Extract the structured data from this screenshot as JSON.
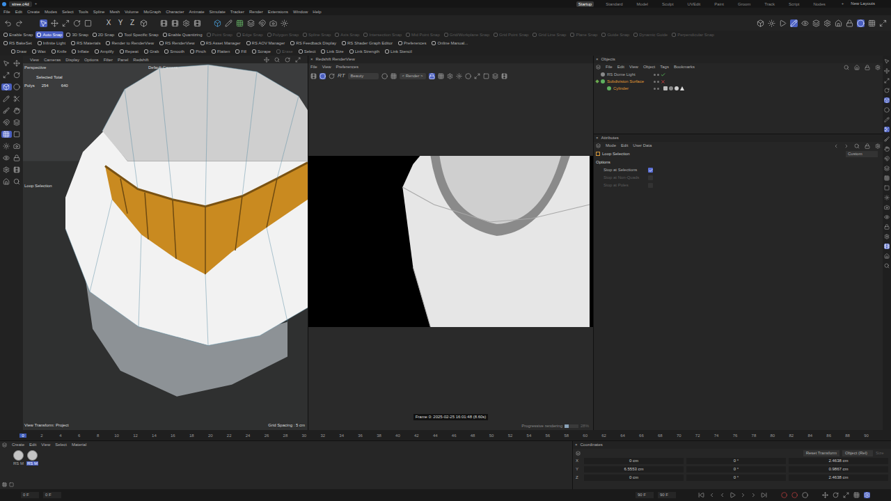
{
  "titlebar": {
    "file_tab": {
      "label": "stree.c4d",
      "selected": true
    },
    "new_tab": "+",
    "layouts": [
      {
        "label": "Startup",
        "selected": true
      },
      {
        "label": "Standard",
        "selected": false
      },
      {
        "label": "Model",
        "selected": false
      },
      {
        "label": "Sculpt",
        "selected": false
      },
      {
        "label": "UVEdit",
        "selected": false
      },
      {
        "label": "Paint",
        "selected": false
      },
      {
        "label": "Groom",
        "selected": false
      },
      {
        "label": "Track",
        "selected": false
      },
      {
        "label": "Script",
        "selected": false
      },
      {
        "label": "Nodes",
        "selected": false
      }
    ],
    "add_layout": "+",
    "new_layouts": "New Layouts"
  },
  "menu": [
    "File",
    "Edit",
    "Create",
    "Modes",
    "Select",
    "Tools",
    "Spline",
    "Mesh",
    "Volume",
    "MoGraph",
    "Character",
    "Animate",
    "Simulate",
    "Tracker",
    "Render",
    "Extensions",
    "Window",
    "Help"
  ],
  "toolbar": {
    "axis_locks": [
      {
        "label": "X",
        "on": false
      },
      {
        "label": "Y",
        "on": false
      },
      {
        "label": "Z",
        "on": false
      }
    ]
  },
  "snap_bar": [
    {
      "label": "Enable Snap",
      "on": false,
      "disabled": false
    },
    {
      "label": "Auto Snap",
      "on": true,
      "disabled": false
    },
    {
      "label": "3D Snap",
      "on": false,
      "disabled": false
    },
    {
      "label": "2D Snap",
      "on": false,
      "disabled": false
    },
    {
      "label": "Tool Specific Snap",
      "on": false,
      "disabled": false
    },
    {
      "label": "Enable Quantizing",
      "on": false,
      "disabled": false
    },
    {
      "label": "Point Snap",
      "on": false,
      "disabled": true
    },
    {
      "label": "Edge Snap",
      "on": false,
      "disabled": true
    },
    {
      "label": "Polygon Snap",
      "on": false,
      "disabled": true
    },
    {
      "label": "Spline Snap",
      "on": false,
      "disabled": true
    },
    {
      "label": "Axis Snap",
      "on": false,
      "disabled": true
    },
    {
      "label": "Intersection Snap",
      "on": false,
      "disabled": true
    },
    {
      "label": "Mid Point Snap",
      "on": false,
      "disabled": true
    },
    {
      "label": "Grid/Workplane Snap",
      "on": false,
      "disabled": true
    },
    {
      "label": "Grid Point Snap",
      "on": false,
      "disabled": true
    },
    {
      "label": "Grid Line Snap",
      "on": false,
      "disabled": true
    },
    {
      "label": "Plane Snap",
      "on": false,
      "disabled": true
    },
    {
      "label": "Guide Snap",
      "on": false,
      "disabled": true
    },
    {
      "label": "Dynamic Guide",
      "on": false,
      "disabled": true
    },
    {
      "label": "Perpendicular Snap",
      "on": false,
      "disabled": true
    }
  ],
  "redshift_bar": [
    {
      "label": "RS BakeSet",
      "on": false,
      "disabled": false
    },
    {
      "label": "Infinite Light",
      "on": false,
      "disabled": false
    },
    {
      "label": "RS Materials",
      "on": false,
      "disabled": false
    },
    {
      "label": "Render to RenderView",
      "on": false,
      "disabled": false
    },
    {
      "label": "RS RenderView",
      "on": false,
      "disabled": false
    },
    {
      "label": "RS Asset Manager",
      "on": false,
      "disabled": false
    },
    {
      "label": "RS AOV Manager",
      "on": false,
      "disabled": false
    },
    {
      "label": "RS Feedback Display",
      "on": false,
      "disabled": false
    },
    {
      "label": "RS Shader Graph Editor",
      "on": false,
      "disabled": false
    },
    {
      "label": "Preferences",
      "on": false,
      "disabled": false
    },
    {
      "label": "Online Manual...",
      "on": false,
      "disabled": false
    }
  ],
  "sculpt_bar": [
    {
      "label": "Draw",
      "on": false,
      "disabled": false
    },
    {
      "label": "Wax",
      "on": false,
      "disabled": false
    },
    {
      "label": "Knife",
      "on": false,
      "disabled": false
    },
    {
      "label": "Inflate",
      "on": false,
      "disabled": false
    },
    {
      "label": "Amplify",
      "on": false,
      "disabled": false
    },
    {
      "label": "Repeat",
      "on": false,
      "disabled": false
    },
    {
      "label": "Grab",
      "on": false,
      "disabled": false
    },
    {
      "label": "Smooth",
      "on": false,
      "disabled": false
    },
    {
      "label": "Pinch",
      "on": false,
      "disabled": false
    },
    {
      "label": "Flatten",
      "on": false,
      "disabled": false
    },
    {
      "label": "Fill",
      "on": false,
      "disabled": false
    },
    {
      "label": "Scrape",
      "on": false,
      "disabled": false
    },
    {
      "label": "Erase",
      "on": false,
      "disabled": true
    },
    {
      "label": "Select",
      "on": false,
      "disabled": false
    },
    {
      "label": "Link Size",
      "on": false,
      "disabled": false
    },
    {
      "label": "Link Strength",
      "on": false,
      "disabled": false
    },
    {
      "label": "Link Stencil",
      "on": false,
      "disabled": false
    }
  ],
  "viewport": {
    "menu": [
      "View",
      "Cameras",
      "Display",
      "Options",
      "Filter",
      "Panel",
      "Redshift"
    ],
    "camera": "Perspective",
    "default_camera": "Default Camera",
    "stats": {
      "title": "Selected Total",
      "label": "Polys",
      "selected": "254",
      "total": "640"
    },
    "tool_label": "Loop Selection",
    "view_transform": "View Transform: Project",
    "grid_spacing": "Grid Spacing : 5 cm"
  },
  "render_view": {
    "title": "Redshift RenderView",
    "close": "×",
    "menu": [
      "File",
      "View",
      "Preferences"
    ],
    "rt": "RT",
    "aov": "Beauty",
    "render_button": "< Render >",
    "frame_info": "Frame 0: 2025-02-25 16:01:48 (8.60s)",
    "progress_label": "Progressive rendering",
    "progress": {
      "level": 0.3,
      "reading": "28%"
    }
  },
  "objects": {
    "title": "Objects",
    "close": "×",
    "menu": [
      "File",
      "Edit",
      "View",
      "Object",
      "Tags",
      "Bookmarks"
    ],
    "items": [
      {
        "name": "RS Dome Light",
        "selected": false,
        "kind": "check",
        "has_tags": false,
        "expanded": false,
        "children": []
      },
      {
        "name": "Subdivision Surface",
        "selected": true,
        "kind": "cross",
        "has_tags": false,
        "expanded": true,
        "children": [
          {
            "name": "Cylinder",
            "selected": true,
            "kind": "none",
            "has_tags": true,
            "expanded": false,
            "children": []
          }
        ]
      }
    ]
  },
  "attributes": {
    "title": "Attributes",
    "close": "×",
    "menu": [
      "Mode",
      "Edit",
      "User Data"
    ],
    "tool": "Loop Selection",
    "preset": "Custom",
    "section": "Options",
    "options": [
      {
        "label": "Stop at Selections",
        "checked": true,
        "disabled": false
      },
      {
        "label": "Stop at Non-Quads",
        "checked": false,
        "disabled": true
      },
      {
        "label": "Stop at Poles",
        "checked": false,
        "disabled": true
      }
    ]
  },
  "timeline": {
    "current": "0",
    "ticks": [
      "0",
      "2",
      "4",
      "6",
      "8",
      "10",
      "12",
      "14",
      "16",
      "18",
      "20",
      "22",
      "24",
      "26",
      "28",
      "30",
      "32",
      "34",
      "36",
      "38",
      "40",
      "42",
      "44",
      "46",
      "48",
      "50",
      "52",
      "54",
      "56",
      "58",
      "60",
      "62",
      "64",
      "66",
      "68",
      "70",
      "72",
      "74",
      "76",
      "78",
      "80",
      "82",
      "84",
      "86",
      "88",
      "90"
    ]
  },
  "materials": {
    "menu": [
      "Create",
      "Edit",
      "View",
      "Select",
      "Material"
    ],
    "items": [
      {
        "label": "RS M",
        "selected": false
      },
      {
        "label": "RS M",
        "selected": true
      }
    ]
  },
  "coordinates": {
    "title": "Coordinates",
    "close": "×",
    "reset": "Reset Transform",
    "mode": "Object (Rel)",
    "size_mode": "Size",
    "rows": [
      {
        "axis": "X",
        "position": "0 cm",
        "rotation": "0 °",
        "size": "2.4638 cm"
      },
      {
        "axis": "Y",
        "position": "6.5553 cm",
        "rotation": "0 °",
        "size": "0.9867 cm"
      },
      {
        "axis": "Z",
        "position": "0 cm",
        "rotation": "0 °",
        "size": "2.4638 cm"
      }
    ]
  },
  "playbar": {
    "start": "0 F",
    "current": "0 F",
    "end": "90 F",
    "preview_end": "90 F"
  }
}
